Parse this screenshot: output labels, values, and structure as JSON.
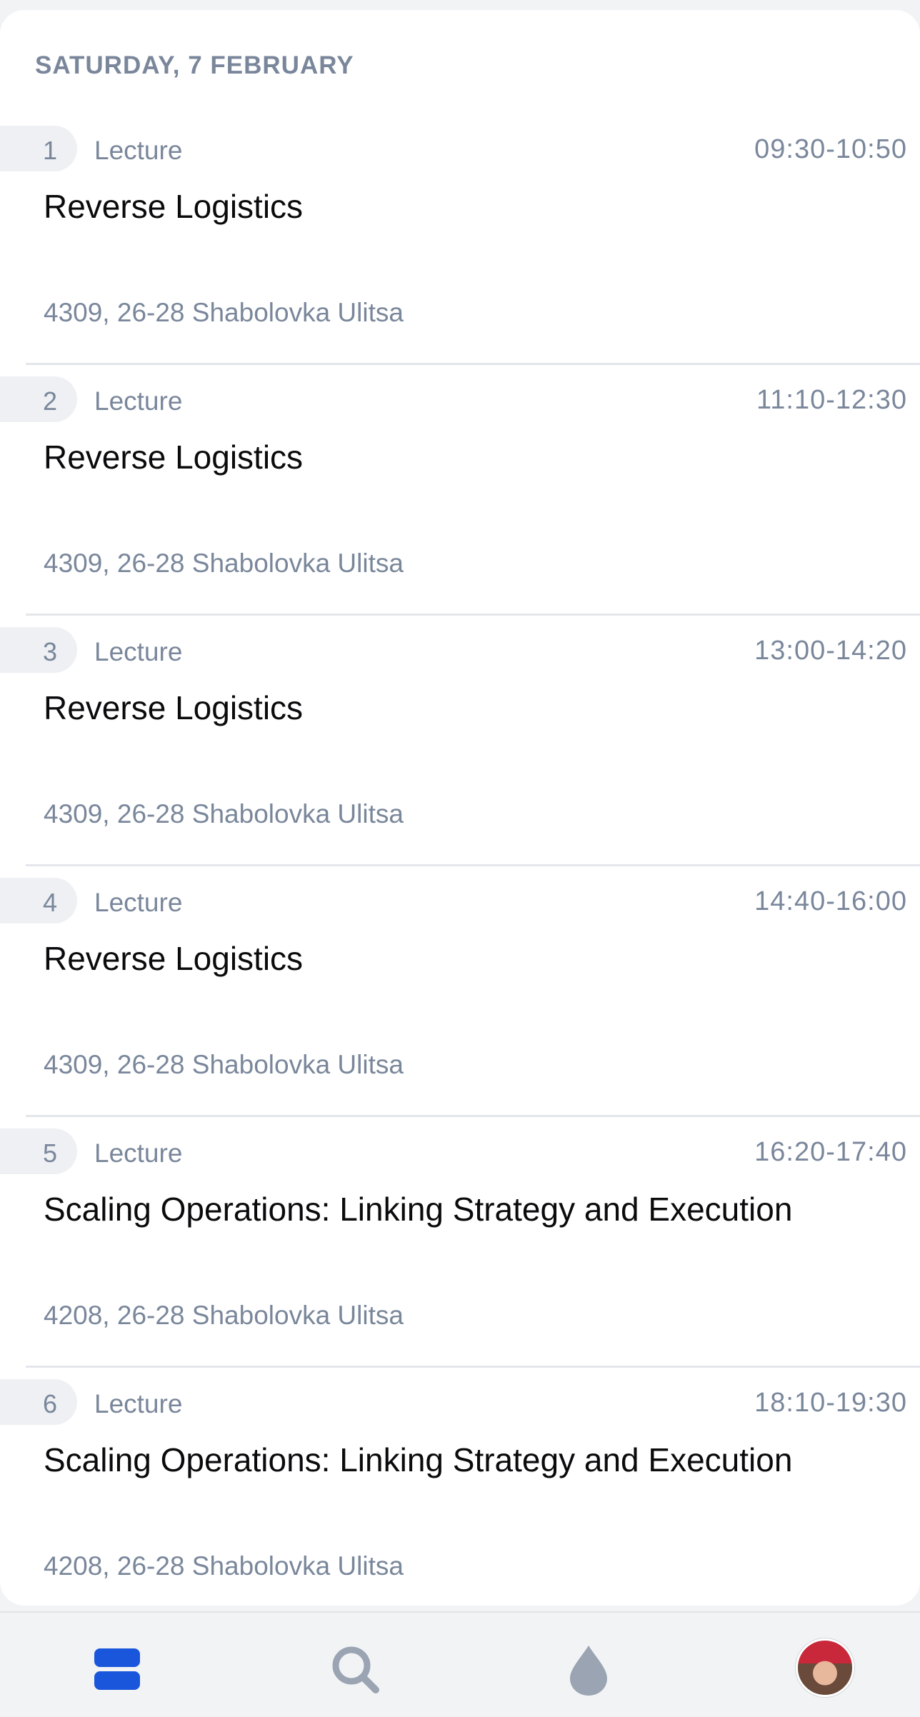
{
  "day_header": "SATURDAY, 7 FEBRUARY",
  "lessons": [
    {
      "num": "1",
      "type": "Lecture",
      "time": "09:30-10:50",
      "title": "Reverse Logistics",
      "location": "4309, 26-28 Shabolovka Ulitsa"
    },
    {
      "num": "2",
      "type": "Lecture",
      "time": "11:10-12:30",
      "title": "Reverse Logistics",
      "location": "4309, 26-28 Shabolovka Ulitsa"
    },
    {
      "num": "3",
      "type": "Lecture",
      "time": "13:00-14:20",
      "title": "Reverse Logistics",
      "location": "4309, 26-28 Shabolovka Ulitsa"
    },
    {
      "num": "4",
      "type": "Lecture",
      "time": "14:40-16:00",
      "title": "Reverse Logistics",
      "location": "4309, 26-28 Shabolovka Ulitsa"
    },
    {
      "num": "5",
      "type": "Lecture",
      "time": "16:20-17:40",
      "title": "Scaling Operations: Linking Strategy and Execution",
      "location": "4208, 26-28 Shabolovka Ulitsa"
    },
    {
      "num": "6",
      "type": "Lecture",
      "time": "18:10-19:30",
      "title": "Scaling Operations: Linking Strategy and Execution",
      "location": "4208, 26-28 Shabolovka Ulitsa"
    }
  ],
  "tabbar": {
    "items": [
      {
        "icon": "schedule-icon",
        "active": true,
        "color": "#1a56db"
      },
      {
        "icon": "search-icon",
        "active": false,
        "color": "#9aa4b2"
      },
      {
        "icon": "drop-icon",
        "active": false,
        "color": "#9aa4b2"
      },
      {
        "icon": "avatar",
        "active": false
      }
    ]
  },
  "colors": {
    "accent": "#1a56db",
    "muted_text": "#7a879b",
    "title_text": "#0b0b0d",
    "divider": "#e3e6ea"
  }
}
